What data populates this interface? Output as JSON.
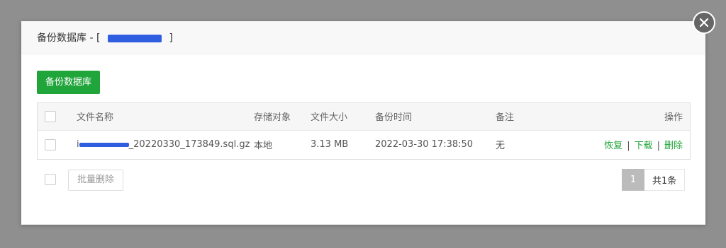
{
  "dialog": {
    "title_prefix": "备份数据库 - [",
    "title_suffix": "]",
    "backup_button": "备份数据库"
  },
  "table": {
    "headers": {
      "name": "文件名称",
      "storage": "存储对象",
      "size": "文件大小",
      "time": "备份时间",
      "note": "备注",
      "ops": "操作"
    },
    "rows": [
      {
        "name_prefix": "i",
        "name_suffix": "_20220330_173849.sql.gz",
        "storage": "本地",
        "size": "3.13 MB",
        "time": "2022-03-30 17:38:50",
        "note": "无",
        "ops": {
          "restore": "恢复",
          "download": "下载",
          "delete": "删除",
          "separator": "|"
        }
      }
    ]
  },
  "footer": {
    "batch_delete": "批量删除",
    "page_current": "1",
    "page_total": "共1条"
  },
  "colors": {
    "accent_green": "#20a53a",
    "redaction_blue": "#2f5fe0",
    "overlay_gray": "#8f8f8f"
  },
  "icons": {
    "close": "close-icon"
  }
}
